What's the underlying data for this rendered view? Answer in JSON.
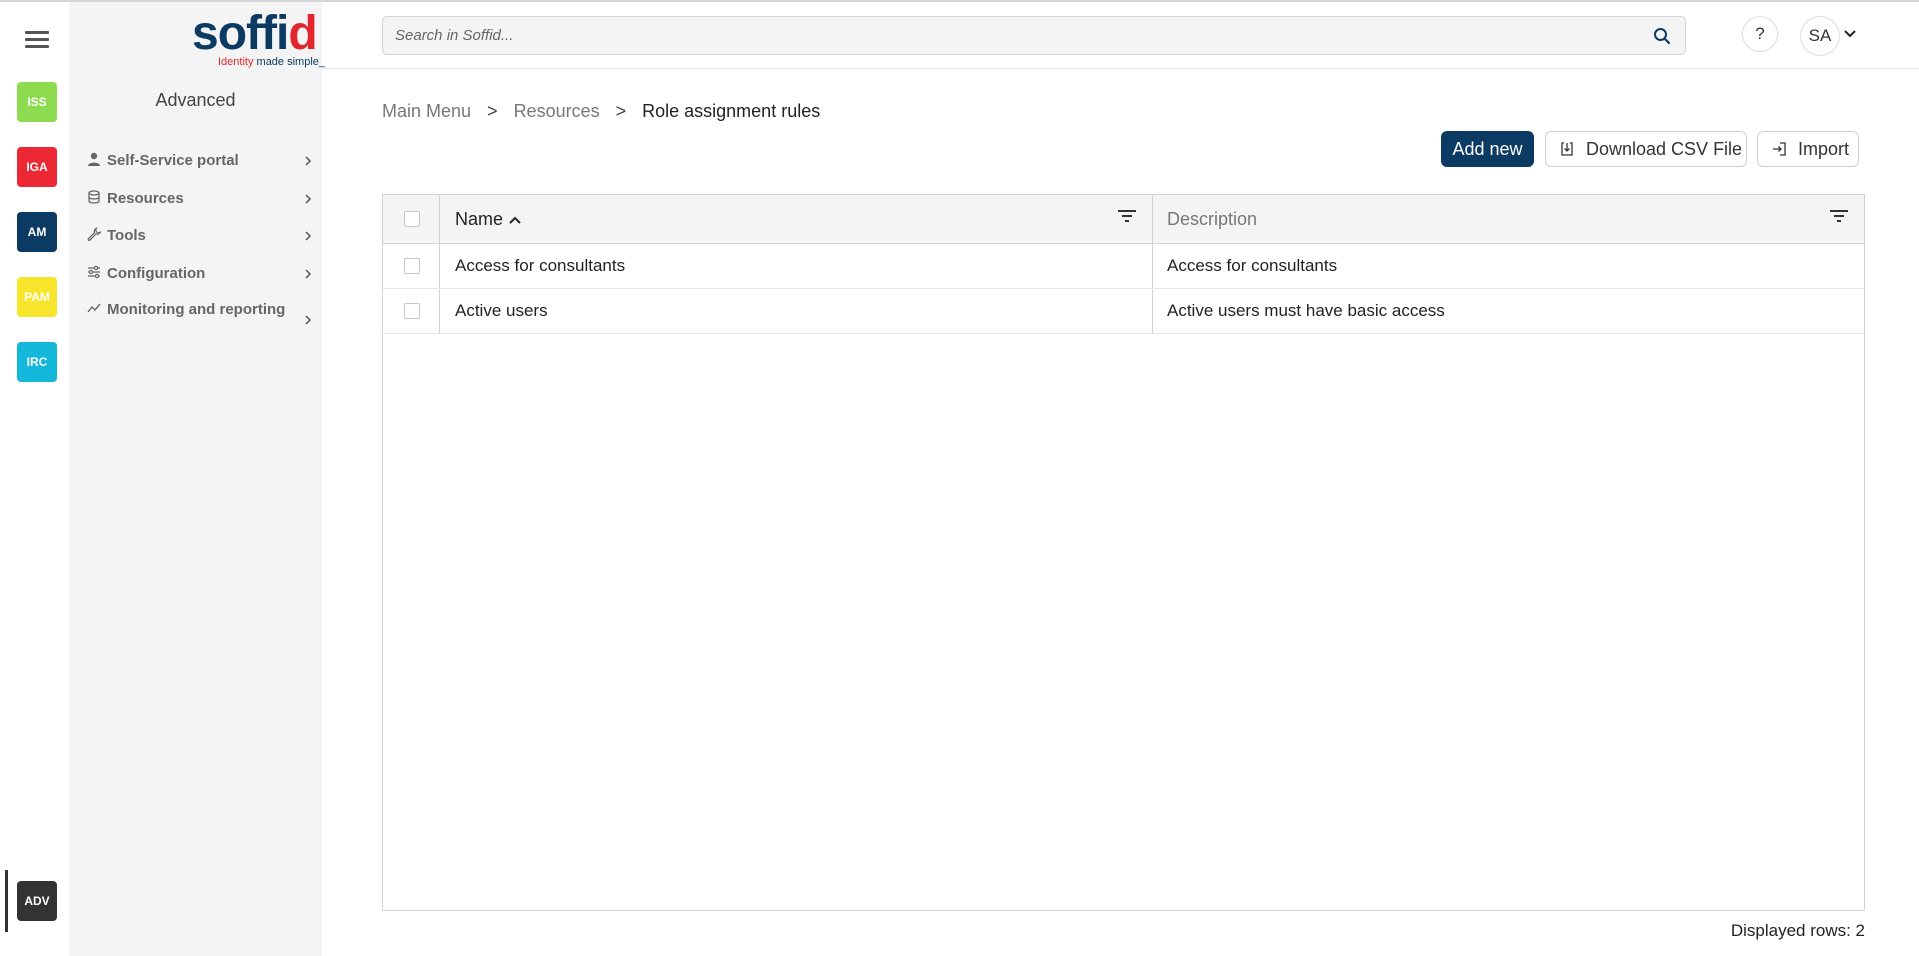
{
  "app": {
    "logo_text_main": "soffi",
    "logo_text_accent": "d",
    "logo_tagline_accent": "Identity",
    "logo_tagline_rest": " made simple_"
  },
  "colors": {
    "brand_navy": "#0b3a63",
    "brand_red": "#e1262d",
    "iss": "#8ddc4f",
    "iga": "#ec2834",
    "am": "#0b3a63",
    "pam": "#f6e52b",
    "irc": "#12b7d9",
    "adv": "#333333"
  },
  "modules": [
    {
      "code": "ISS"
    },
    {
      "code": "IGA"
    },
    {
      "code": "AM"
    },
    {
      "code": "PAM"
    },
    {
      "code": "IRC"
    }
  ],
  "active_module": {
    "code": "ADV"
  },
  "menu": {
    "title": "Advanced",
    "items": [
      {
        "label": "Self-Service portal",
        "icon": "user-icon"
      },
      {
        "label": "Resources",
        "icon": "database-icon"
      },
      {
        "label": "Tools",
        "icon": "wrench-icon"
      },
      {
        "label": "Configuration",
        "icon": "sliders-icon"
      },
      {
        "label": "Monitoring and reporting",
        "icon": "chart-line-icon"
      }
    ]
  },
  "header": {
    "search_placeholder": "Search in Soffid...",
    "help_label": "?",
    "avatar_initials": "SA"
  },
  "breadcrumb": {
    "items": [
      "Main Menu",
      "Resources"
    ],
    "separator": ">",
    "current": "Role assignment rules"
  },
  "toolbar": {
    "add_label": "Add new",
    "csv_label": "Download CSV File",
    "import_label": "Import"
  },
  "table": {
    "columns": [
      "Name",
      "Description"
    ],
    "rows": [
      {
        "name": "Access for consultants",
        "description": "Access for consultants"
      },
      {
        "name": "Active users",
        "description": "Active users must have basic access"
      }
    ],
    "footer": "Displayed rows: 2"
  }
}
